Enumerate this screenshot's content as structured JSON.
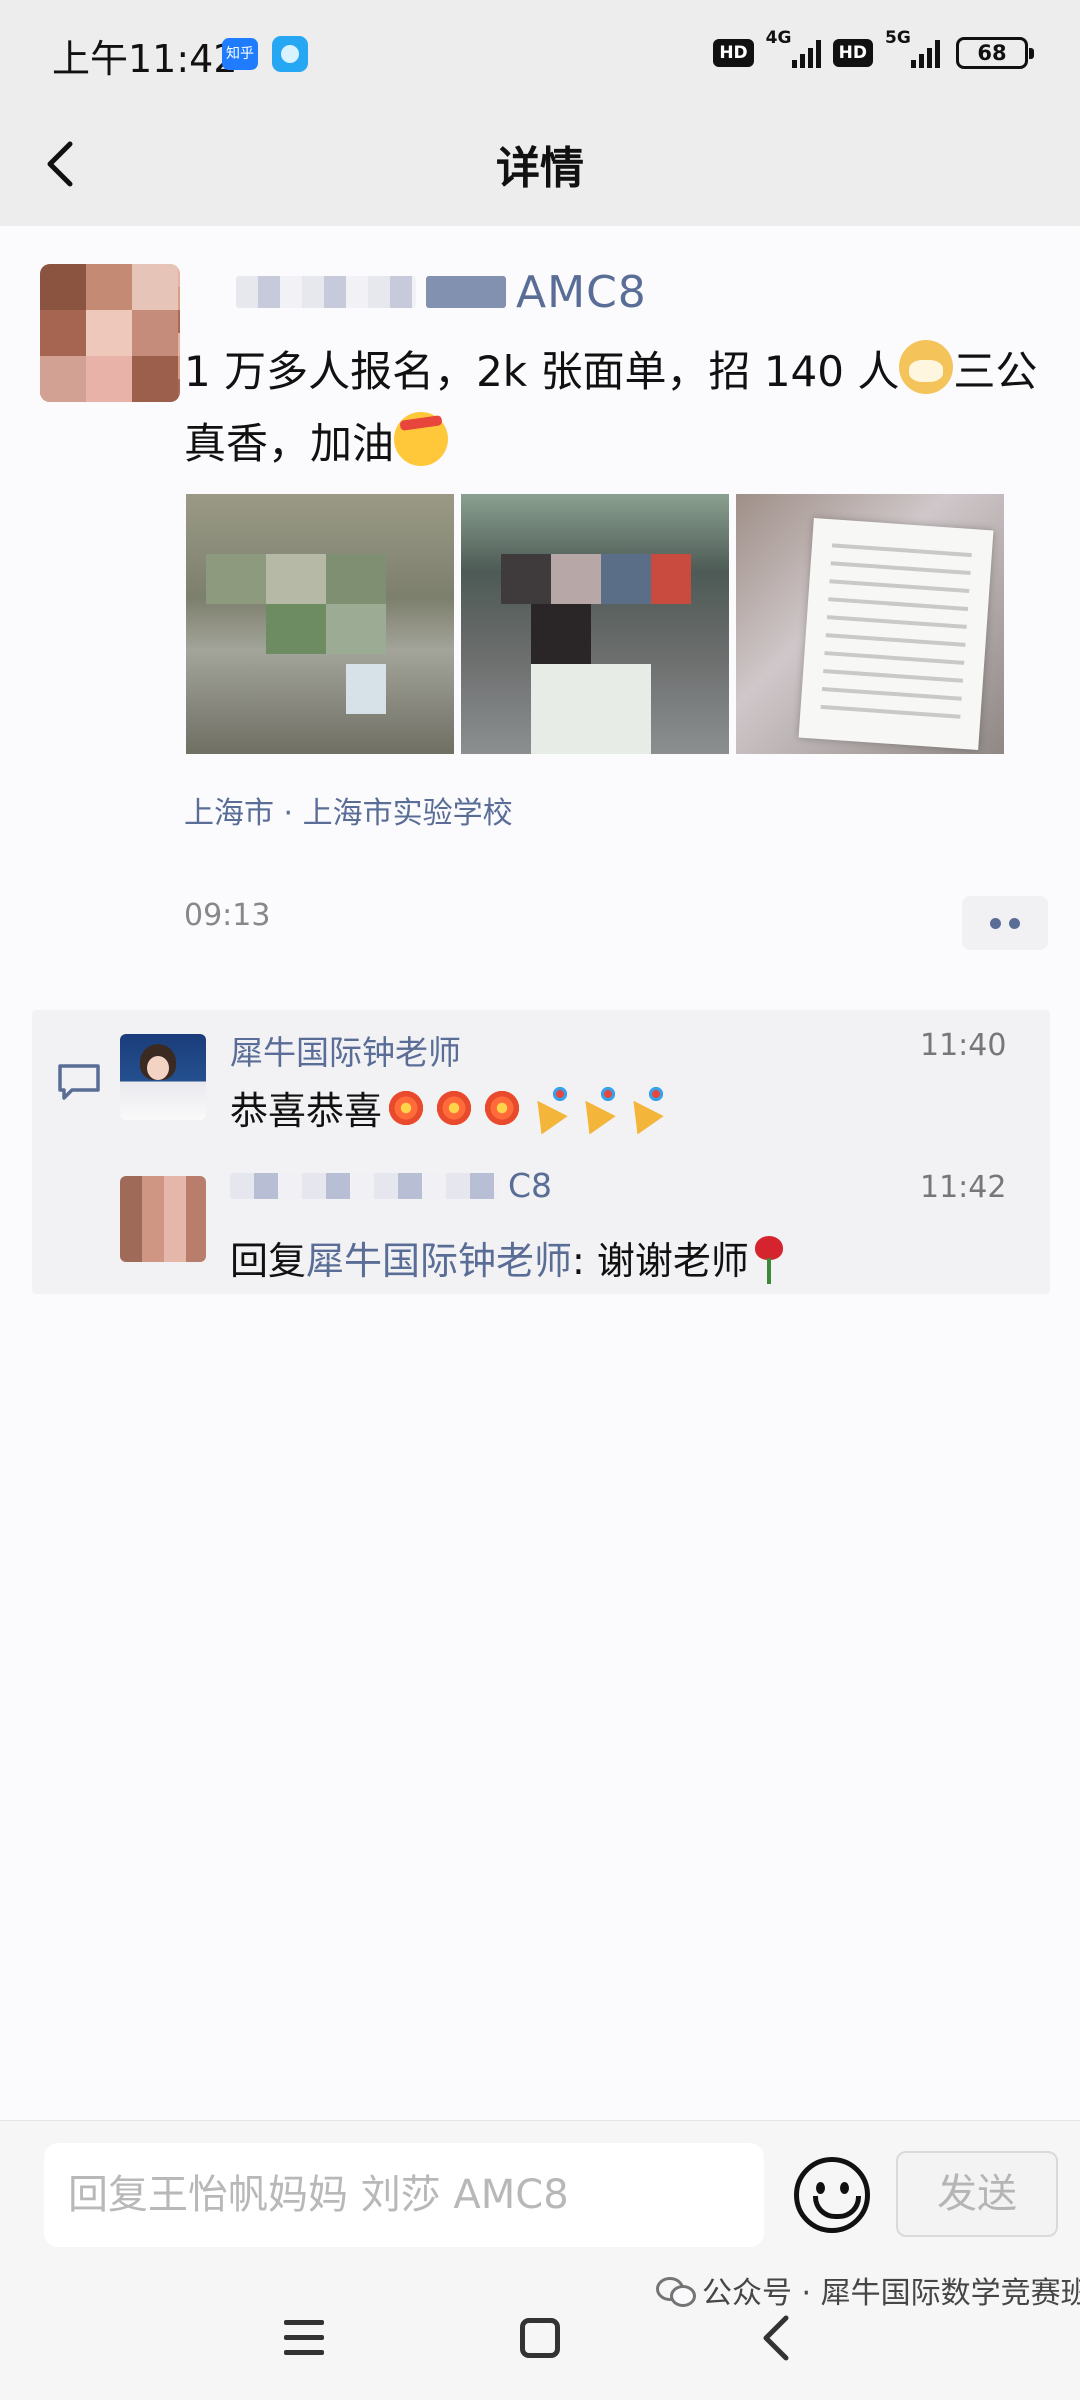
{
  "status_bar": {
    "time": "上午11:42",
    "app_badge": "知乎",
    "hd1": "HD",
    "net1": "4G",
    "hd2": "HD",
    "net2": "5G",
    "battery": "68"
  },
  "header": {
    "title": "详情"
  },
  "post": {
    "author_visible_suffix": "AMC8",
    "text_part1": "1 万多人报名，2k 张面单，招 140 人",
    "text_part2": "三公真香，加油",
    "location": "上海市 · 上海市实验学校",
    "time": "09:13"
  },
  "comments": [
    {
      "name": "犀牛国际钟老师",
      "time": "11:40",
      "text": "恭喜恭喜"
    },
    {
      "name_visible_suffix": "C8",
      "time": "11:42",
      "reply_prefix": "回复",
      "reply_target": "犀牛国际钟老师",
      "text": ": 谢谢老师"
    }
  ],
  "input_bar": {
    "placeholder": "回复王怡帆妈妈 刘莎 AMC8",
    "send_label": "发送"
  },
  "watermark": "公众号 · 犀牛国际数学竞赛班",
  "colors": {
    "link": "#5a6d96",
    "header_bg": "#ededed",
    "comment_bg": "#f2f2f5"
  }
}
